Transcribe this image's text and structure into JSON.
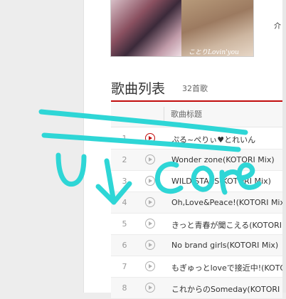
{
  "header": {
    "cover_caption": "ことりLovin'you",
    "side_label": "介"
  },
  "playlist": {
    "section_title": "歌曲列表",
    "song_count": "32首歌",
    "column_title": "歌曲标题"
  },
  "songs": [
    {
      "num": "1",
      "title": "ぷる~ぺりぃ♥とれいん"
    },
    {
      "num": "2",
      "title": "Wonder zone(KOTORI Mix)"
    },
    {
      "num": "3",
      "title": "WILD STARS(KOTORI Mix)"
    },
    {
      "num": "4",
      "title": "Oh,Love&Peace!(KOTORI Mix)"
    },
    {
      "num": "5",
      "title": "きっと青春が聞こえる(KOTORI Mix)"
    },
    {
      "num": "6",
      "title": "No brand girls(KOTORI Mix)"
    },
    {
      "num": "7",
      "title": "もぎゅっとloveで接近中!(KOTORI Mix)"
    },
    {
      "num": "8",
      "title": "これからのSomeday(KOTORI Mix)"
    }
  ],
  "colors": {
    "accent": "#c20c0c",
    "scribble": "#2ed6d6"
  },
  "icons": {
    "play": "play-circle-icon"
  }
}
